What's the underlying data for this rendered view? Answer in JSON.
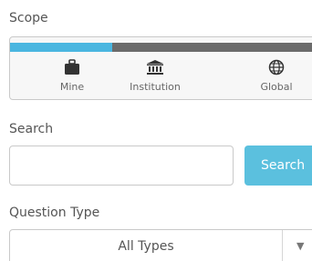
{
  "scope": {
    "label": "Scope",
    "progress_fraction": 0.33,
    "options": [
      {
        "label": "Mine",
        "icon": "briefcase-icon"
      },
      {
        "label": "Institution",
        "icon": "institution-icon"
      },
      {
        "label": "Global",
        "icon": "globe-icon"
      }
    ]
  },
  "search": {
    "label": "Search",
    "value": "",
    "placeholder": "",
    "button_label": "Search"
  },
  "question_type": {
    "label": "Question Type",
    "selected": "All Types",
    "caret": "▼"
  },
  "colors": {
    "accent": "#5bc0de",
    "progress_fill": "#4ab6e0",
    "progress_track": "#6b6b6b"
  }
}
